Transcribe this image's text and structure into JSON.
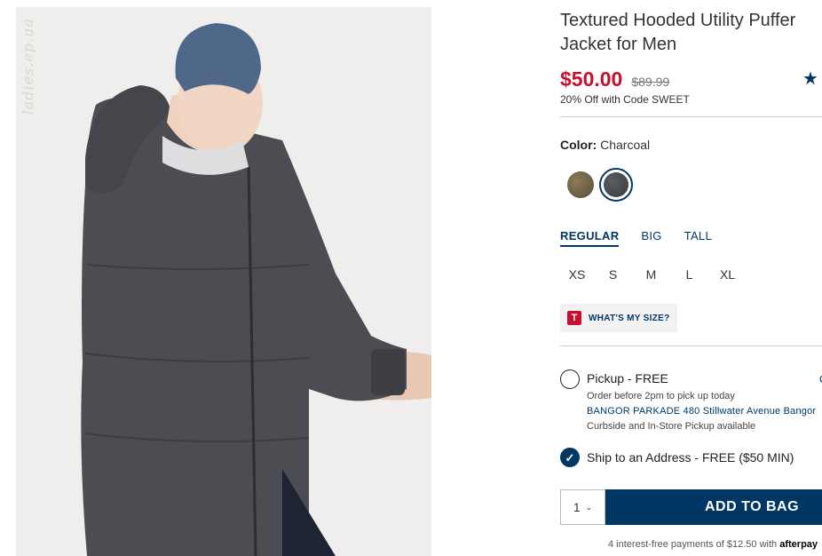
{
  "watermark": "ladies.ep.ua",
  "product": {
    "title": "Textured Hooded Utility Puffer Jacket for Men",
    "price": "$50.00",
    "original_price": "$89.99",
    "promo": "20% Off with Code SWEET",
    "rating_icon": "star-icon"
  },
  "color": {
    "label": "Color:",
    "value": "Charcoal",
    "swatches": [
      {
        "name": "Olive",
        "hex": "#6b5c40"
      },
      {
        "name": "Charcoal",
        "hex": "#45464b",
        "selected": true
      }
    ]
  },
  "fit_tabs": [
    "REGULAR",
    "BIG",
    "TALL"
  ],
  "sizes": [
    "XS",
    "S",
    "M",
    "L",
    "XL"
  ],
  "size_help": {
    "logo_letter": "T",
    "label": "WHAT'S MY SIZE?"
  },
  "pickup": {
    "title": "Pickup - FREE",
    "line1": "Order before 2pm to pick up today",
    "store": "BANGOR PARKADE 480 Stillwater Avenue  Bangor",
    "line3": "Curbside and In-Store Pickup available",
    "change_marker": "C"
  },
  "ship": {
    "title": "Ship to an Address - FREE ($50 MIN)"
  },
  "cart": {
    "quantity": "1",
    "add_label": "ADD TO BAG"
  },
  "afterpay": {
    "text": "4 interest-free payments of $12.50 with",
    "brand": "afterpay"
  },
  "colors": {
    "brand_navy": "#003764",
    "sale_red": "#c8102e"
  }
}
